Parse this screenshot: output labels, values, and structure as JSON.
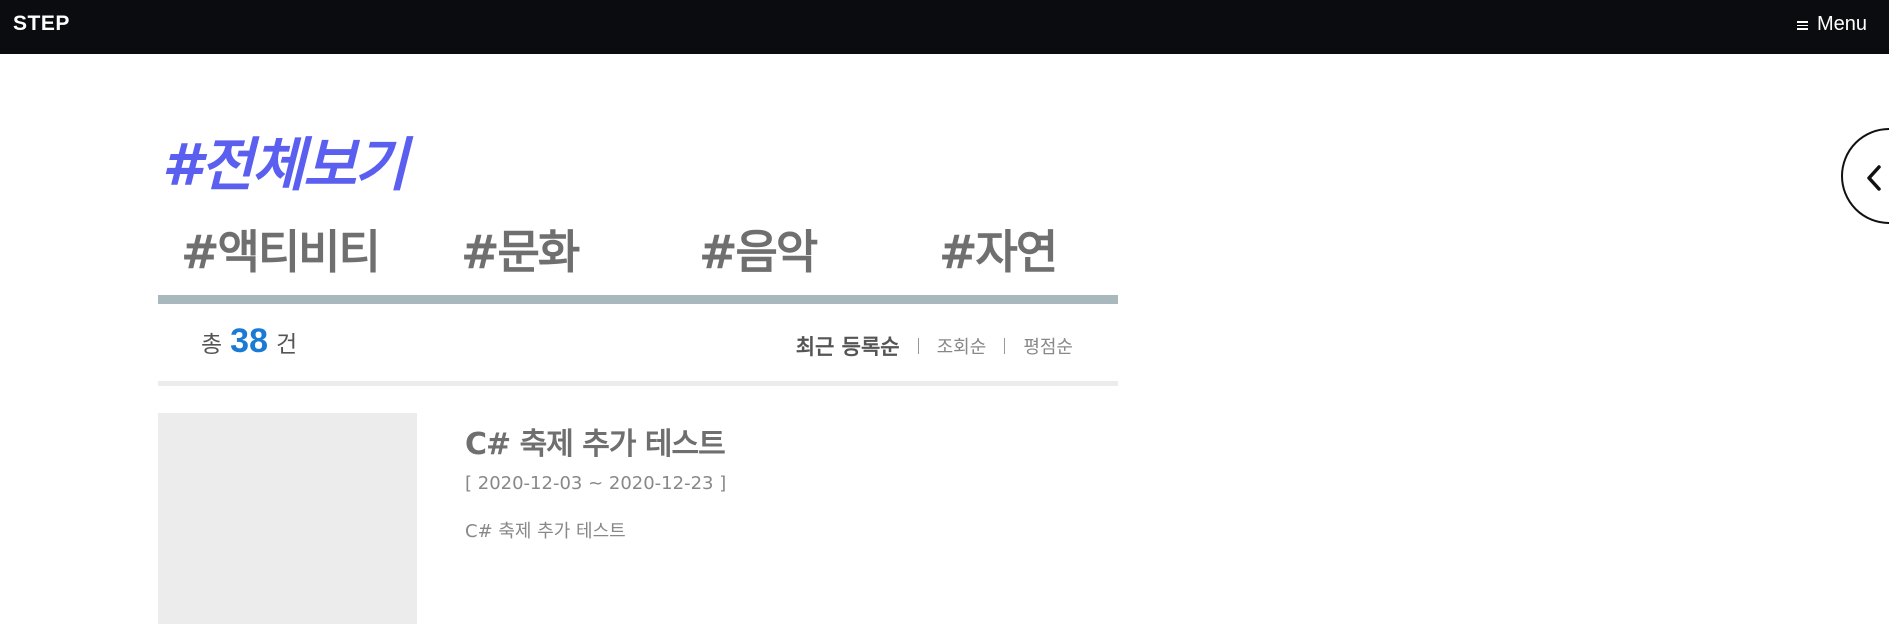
{
  "header": {
    "logo": "STEP",
    "menu_label": "Menu",
    "menu_icon": "hamburger-icon"
  },
  "page": {
    "title": "#전체보기"
  },
  "categories": [
    {
      "label": "#액티비티"
    },
    {
      "label": "#문화"
    },
    {
      "label": "#음악"
    },
    {
      "label": "#자연"
    }
  ],
  "summary": {
    "prefix": "총",
    "count": "38",
    "suffix": "건"
  },
  "sort_options": [
    {
      "label": "최근 등록순",
      "active": true
    },
    {
      "label": "조회순",
      "active": false
    },
    {
      "label": "평점순",
      "active": false
    }
  ],
  "items": [
    {
      "title": "C# 축제 추가 테스트",
      "date_range": "[ 2020-12-03 ~ 2020-12-23 ]",
      "description": "C# 축제 추가 테스트"
    }
  ],
  "side_toggle": {
    "icon": "chevron-left-icon"
  },
  "colors": {
    "topbar": "#0b0c10",
    "title_accent": "#5b5ff0",
    "count_accent": "#1a7ad4",
    "divider": "#a9b8bd"
  }
}
